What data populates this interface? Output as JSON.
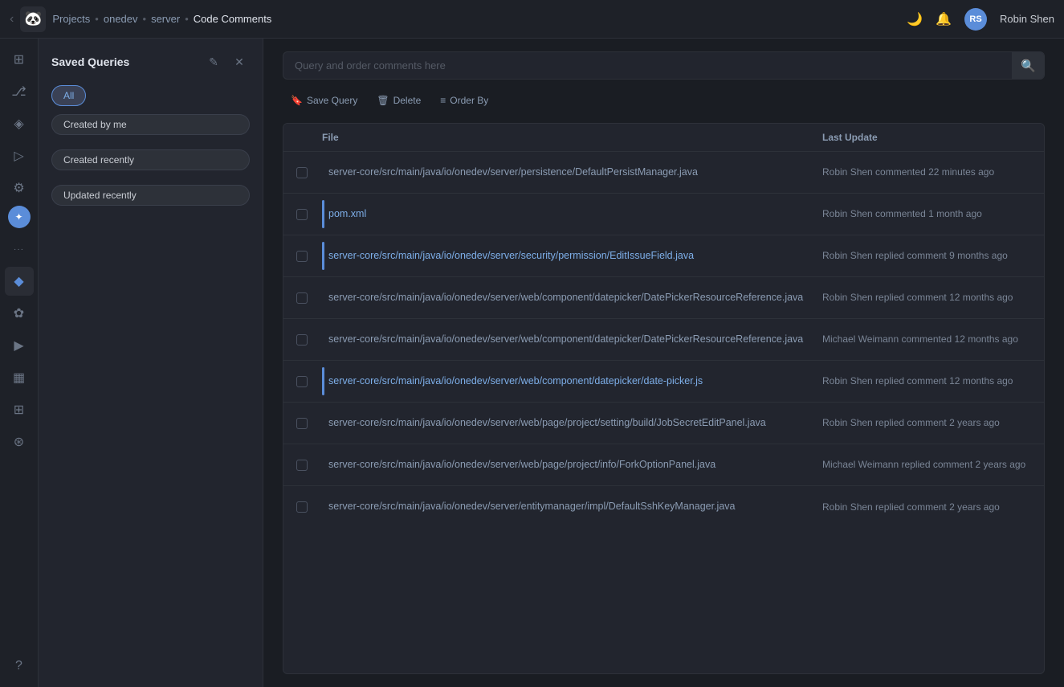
{
  "nav": {
    "logo": "🐼",
    "breadcrumbs": [
      {
        "label": "Projects",
        "sep": "•"
      },
      {
        "label": "onedev",
        "sep": "•"
      },
      {
        "label": "server",
        "sep": "•"
      },
      {
        "label": "Code Comments",
        "current": true
      }
    ],
    "user": {
      "name": "Robin Shen",
      "initials": "RS"
    }
  },
  "sidebar": {
    "icons": [
      {
        "name": "dashboard-icon",
        "symbol": "⊞"
      },
      {
        "name": "git-icon",
        "symbol": "⎇"
      },
      {
        "name": "issues-icon",
        "symbol": "◈"
      },
      {
        "name": "pipeline-icon",
        "symbol": "▷"
      },
      {
        "name": "settings-icon",
        "symbol": "⚙"
      },
      {
        "name": "plugin-icon",
        "symbol": "✦"
      },
      {
        "name": "dots-icon",
        "symbol": "•••"
      },
      {
        "name": "git2-icon",
        "symbol": "◆"
      },
      {
        "name": "test-icon",
        "symbol": "✿"
      },
      {
        "name": "play-icon",
        "symbol": "▶"
      },
      {
        "name": "chart-icon",
        "symbol": "▦"
      },
      {
        "name": "grid-icon",
        "symbol": "⊞"
      },
      {
        "name": "filter-icon",
        "symbol": "⊛"
      }
    ]
  },
  "saved_queries": {
    "title": "Saved Queries",
    "edit_label": "✎",
    "close_label": "✕",
    "filters": [
      {
        "label": "All",
        "active": true
      },
      {
        "label": "Created by me",
        "active": false
      },
      {
        "label": "Created recently",
        "active": false
      },
      {
        "label": "Updated recently",
        "active": false
      }
    ]
  },
  "toolbar": {
    "search_placeholder": "Query and order comments here",
    "save_query_label": "Save Query",
    "delete_label": "Delete",
    "order_by_label": "Order By"
  },
  "table": {
    "col_file": "File",
    "col_update": "Last Update",
    "rows": [
      {
        "file": "server-core/src/main/java/io/onedev/server/persistence/DefaultPersistManager.java",
        "update": "Robin Shen commented 22 minutes ago",
        "accent": false
      },
      {
        "file": "pom.xml",
        "update": "Robin Shen commented 1 month ago",
        "accent": true
      },
      {
        "file": "server-core/src/main/java/io/onedev/server/security/permission/EditIssueField.java",
        "update": "Robin Shen replied comment 9 months ago",
        "accent": true
      },
      {
        "file": "server-core/src/main/java/io/onedev/server/web/component/datepicker/DatePickerResourceReference.java",
        "update": "Robin Shen replied comment 12 months ago",
        "accent": false
      },
      {
        "file": "server-core/src/main/java/io/onedev/server/web/component/datepicker/DatePickerResourceReference.java",
        "update": "Michael Weimann commented 12 months ago",
        "accent": false
      },
      {
        "file": "server-core/src/main/java/io/onedev/server/web/component/datepicker/date-picker.js",
        "update": "Robin Shen replied comment 12 months ago",
        "accent": true
      },
      {
        "file": "server-core/src/main/java/io/onedev/server/web/page/project/setting/build/JobSecretEditPanel.java",
        "update": "Robin Shen replied comment 2 years ago",
        "accent": false
      },
      {
        "file": "server-core/src/main/java/io/onedev/server/web/page/project/info/ForkOptionPanel.java",
        "update": "Michael Weimann replied comment 2 years ago",
        "accent": false
      },
      {
        "file": "server-core/src/main/java/io/onedev/server/entitymanager/impl/DefaultSshKeyManager.java",
        "update": "Robin Shen replied comment 2 years ago",
        "accent": false
      }
    ]
  }
}
